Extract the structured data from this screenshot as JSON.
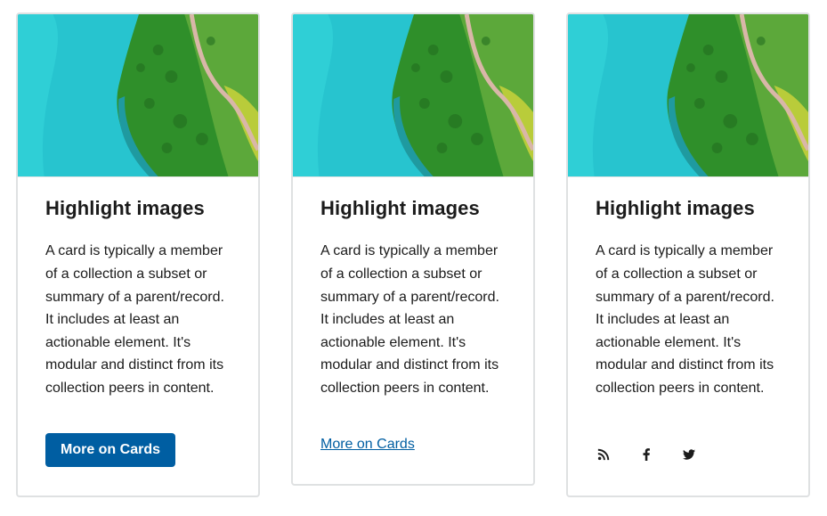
{
  "cards": [
    {
      "title": "Highlight images",
      "text": "A card is typically a member of a collection a subset or summary of a parent/record. It includes at least an actionable element. It's modular and distinct from its collection peers in content.",
      "action": {
        "type": "button",
        "label": "More on Cards"
      }
    },
    {
      "title": "Highlight images",
      "text": "A card is typically a member of a collection a subset or summary of a parent/record. It includes at least an actionable element. It's modular and distinct from its collection peers in content.",
      "action": {
        "type": "link",
        "label": "More on Cards"
      }
    },
    {
      "title": "Highlight images",
      "text": "A card is typically a member of a collection a subset or summary of a parent/record. It includes at least an actionable element. It's modular and distinct from its collection peers in content.",
      "action": {
        "type": "icons",
        "icons": [
          "rss-icon",
          "facebook-icon",
          "twitter-icon"
        ]
      }
    }
  ],
  "colors": {
    "primary": "#005ea2",
    "border": "#dfe1e2",
    "text": "#1b1b1b"
  }
}
